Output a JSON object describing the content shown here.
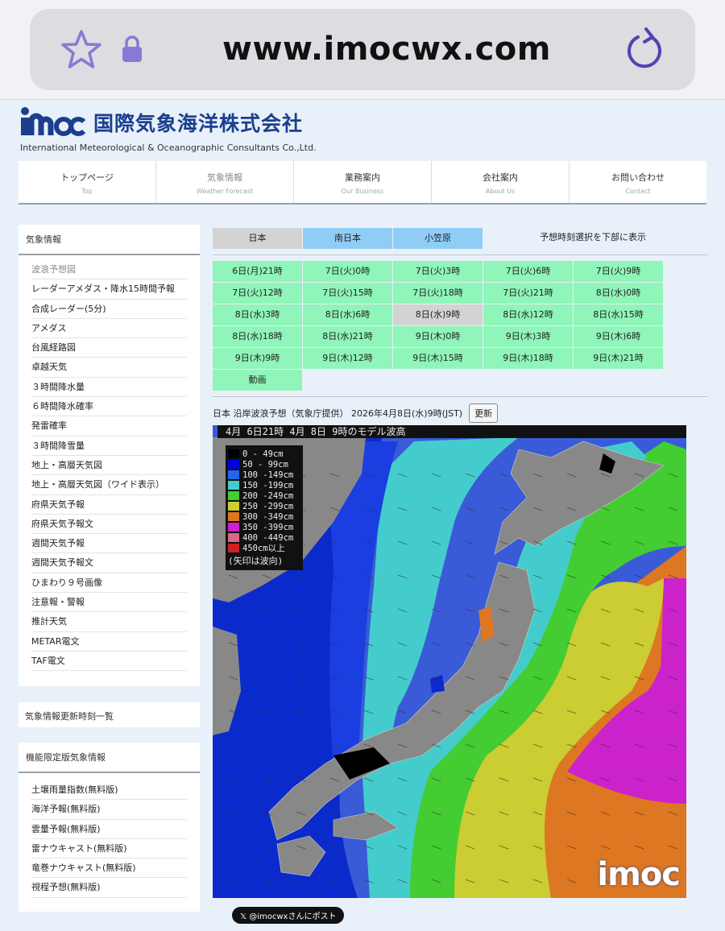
{
  "browser": {
    "url": "www.imocwx.com"
  },
  "site": {
    "logo_mark": "imoc",
    "name_jp": "国際気象海洋株式会社",
    "name_en": "International Meteorological & Oceanographic Consultants Co.,Ltd."
  },
  "topnav": [
    {
      "jp": "トップページ",
      "en": "Top"
    },
    {
      "jp": "気象情報",
      "en": "Weather Forecast"
    },
    {
      "jp": "業務案内",
      "en": "Our Business"
    },
    {
      "jp": "会社案内",
      "en": "About Us"
    },
    {
      "jp": "お問い合わせ",
      "en": "Contact"
    }
  ],
  "sidebar": {
    "title": "気象情報",
    "items": [
      "波浪予想図",
      "レーダーアメダス・降水15時間予報",
      "合成レーダー(5分)",
      "アメダス",
      "台風経路図",
      "卓越天気",
      "３時間降水量",
      "６時間降水確率",
      "発雷確率",
      "３時間降雪量",
      "地上・高層天気図",
      "地上・高層天気図（ワイド表示）",
      "府県天気予報",
      "府県天気予報文",
      "週間天気予報",
      "週間天気予報文",
      "ひまわり９号画像",
      "注意報・警報",
      "推計天気",
      "METAR電文",
      "TAF電文"
    ],
    "update_link": "気象情報更新時刻一覧",
    "limited_title": "機能限定版気象情報",
    "limited_items": [
      "土壌雨量指数(無料版)",
      "海洋予報(無料版)",
      "雲量予報(無料版)",
      "雷ナウキャスト(無料版)",
      "竜巻ナウキャスト(無料版)",
      "視程予想(無料版)"
    ]
  },
  "region_tabs": [
    "日本",
    "南日本",
    "小笠原"
  ],
  "region_note": "予想時刻選択を下部に表示",
  "times": [
    "6日(月)21時",
    "7日(火)0時",
    "7日(火)3時",
    "7日(火)6時",
    "7日(火)9時",
    "7日(火)12時",
    "7日(火)15時",
    "7日(火)18時",
    "7日(火)21時",
    "8日(水)0時",
    "8日(水)3時",
    "8日(水)6時",
    "8日(水)9時",
    "8日(水)12時",
    "8日(水)15時",
    "8日(水)18時",
    "8日(水)21時",
    "9日(木)0時",
    "9日(木)3時",
    "9日(木)6時",
    "9日(木)9時",
    "9日(木)12時",
    "9日(木)15時",
    "9日(木)18時",
    "9日(木)21時",
    "動画"
  ],
  "selected_time": "8日(水)9時",
  "map": {
    "title": "日本 沿岸波浪予想（気象庁提供） 2026年4月8日(水)9時(JST)",
    "refresh_label": "更新",
    "header": "4月 6日21時  4月 8日 9時のモデル波高",
    "legend": [
      {
        "label": "  0 - 49cm",
        "color": "#000000"
      },
      {
        "label": " 50 - 99cm",
        "color": "#0000dd"
      },
      {
        "label": "100 -149cm",
        "color": "#2266ee"
      },
      {
        "label": "150 -199cm",
        "color": "#44cccc"
      },
      {
        "label": "200 -249cm",
        "color": "#44cc33"
      },
      {
        "label": "250 -299cm",
        "color": "#cccc33"
      },
      {
        "label": "300 -349cm",
        "color": "#dd7722"
      },
      {
        "label": "350 -399cm",
        "color": "#cc22cc"
      },
      {
        "label": "400 -449cm",
        "color": "#dd6688"
      },
      {
        "label": "450cm以上",
        "color": "#cc2222"
      }
    ],
    "legend_note": "(矢印は波向)",
    "logo": "imoc"
  },
  "post_button": "𝕏 @imocwxさんにポスト",
  "colors": {
    "accent": "#1b3f8e",
    "time_cell": "#8ff5b8",
    "region_blue": "#8fcdf7",
    "selected": "#d3d3d3"
  }
}
